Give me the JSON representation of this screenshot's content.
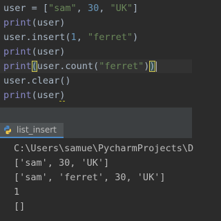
{
  "editor": {
    "lines": [
      {
        "a": "user",
        "b": " = [",
        "c": "\"sam\"",
        "d": ", ",
        "e": "30",
        "f": ", ",
        "g": "\"UK\"",
        "h": "]"
      },
      {
        "fn": "print",
        "rest": "(user)"
      },
      {
        "a": "user.insert(",
        "num": "1",
        "b": ", ",
        "str": "\"ferret\"",
        "c": ")"
      },
      {
        "fn": "print",
        "rest": "(user)"
      },
      {
        "fn": "print",
        "p1": "(",
        "mid": "user.count(",
        "str": "\"ferret\"",
        "p2": ")",
        "p3": ")"
      },
      {
        "text": "user.clear()"
      },
      {
        "fn": "print",
        "rest1": "(user",
        "rest2": ")"
      }
    ]
  },
  "run_panel": {
    "tab_label": "list_insert",
    "icon": "python-icon"
  },
  "console": {
    "lines": [
      "C:\\Users\\samue\\PycharmProjects\\D",
      "['sam', 30, 'UK']",
      "['sam', 'ferret', 30, 'UK']",
      "1",
      "[]"
    ]
  }
}
